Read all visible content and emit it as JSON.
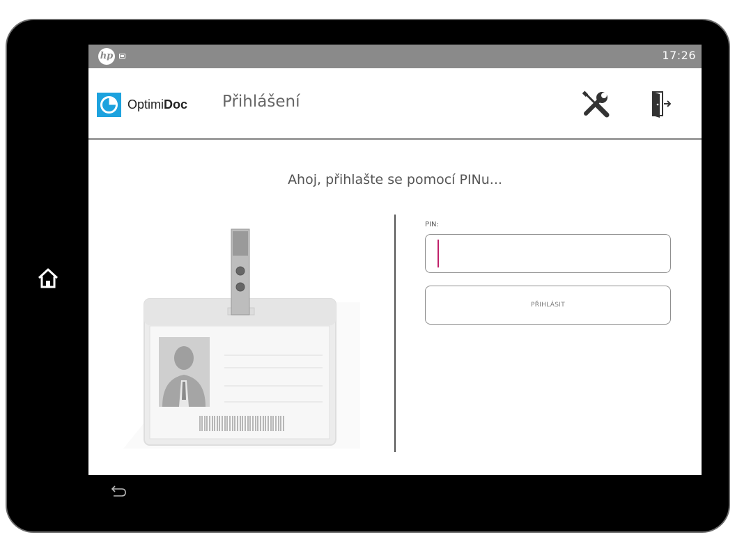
{
  "statusbar": {
    "time": "17:26",
    "hp_logo_text": "hp",
    "status_icon": "image-icon"
  },
  "appbar": {
    "brand_prefix": "Optimi",
    "brand_suffix": "Doc",
    "title": "Přihlášení",
    "tools_icon": "wrench-screwdriver-icon",
    "exit_icon": "door-exit-icon"
  },
  "main": {
    "greeting": "Ahoj, přihlašte se pomocí PINu...",
    "pin_label": "PIN:",
    "pin_value": "",
    "login_label": "PŘIHLÁSIT",
    "illustration": "id-badge-illustration"
  },
  "device": {
    "home_icon": "home-icon",
    "back_icon": "back-arrow-icon"
  },
  "colors": {
    "accent": "#1da2de",
    "caret": "#c0206a",
    "statusbar": "#8a8a8a"
  }
}
